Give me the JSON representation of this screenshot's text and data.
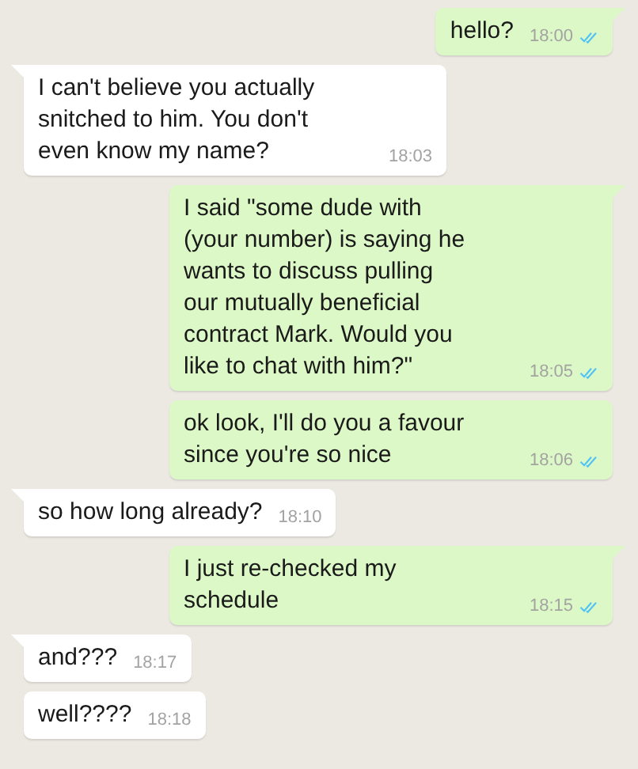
{
  "messages": [
    {
      "kind": "sent",
      "text": "hello?",
      "time": "18:00",
      "read": true,
      "tail": true
    },
    {
      "kind": "received",
      "text": "I can't believe you actually\nsnitched to him. You don't\neven know my name?",
      "time": "18:03",
      "tail": true
    },
    {
      "kind": "sent",
      "text": "I said \"some dude with\n(your number) is saying he\nwants to discuss pulling\nour mutually beneficial\ncontract Mark. Would you\nlike to chat with him?\"",
      "time": "18:05",
      "read": true,
      "tail": true
    },
    {
      "kind": "sent",
      "text": "ok look, I'll do you a favour\nsince you're so nice",
      "time": "18:06",
      "read": true,
      "tail": false
    },
    {
      "kind": "received",
      "text": "so how long already?",
      "time": "18:10",
      "tail": true
    },
    {
      "kind": "sent",
      "text": "I just re-checked my\nschedule",
      "time": "18:15",
      "read": true,
      "tail": true
    },
    {
      "kind": "received",
      "text": "and???",
      "time": "18:17",
      "tail": true
    },
    {
      "kind": "received",
      "text": "well????",
      "time": "18:18",
      "tail": false
    }
  ]
}
